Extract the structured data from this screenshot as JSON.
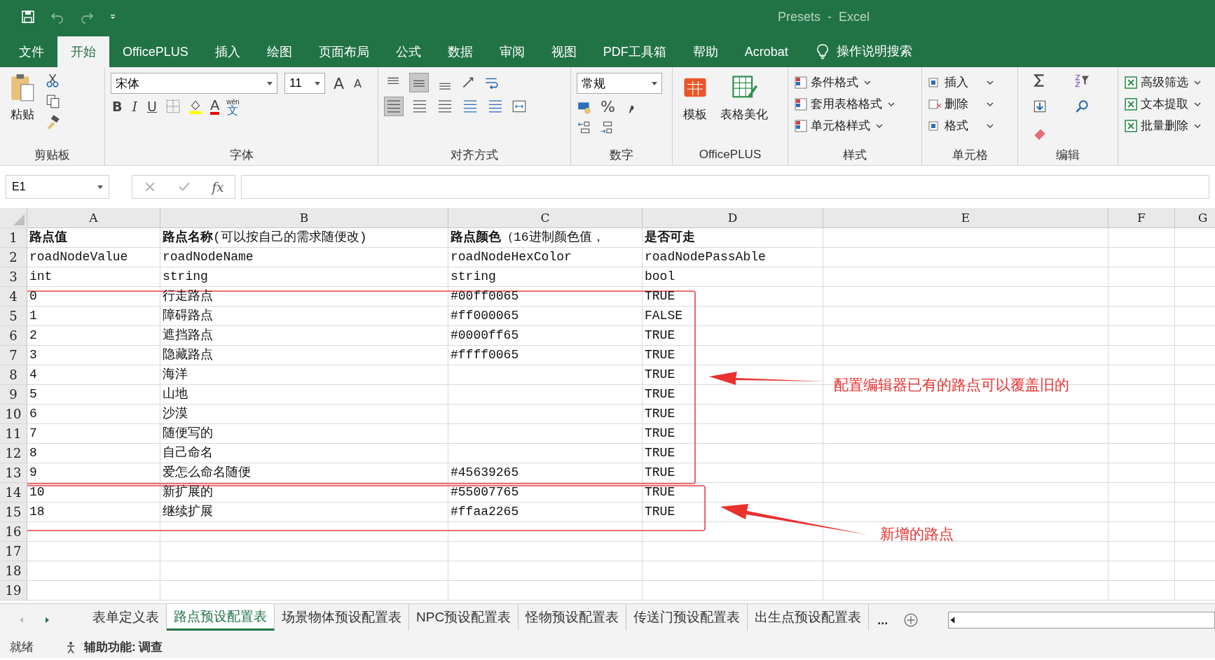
{
  "title_bar": {
    "title": "Presets  -  Excel"
  },
  "menu_tabs": [
    {
      "label": "文件",
      "selected": false
    },
    {
      "label": "开始",
      "selected": true
    },
    {
      "label": "OfficePLUS",
      "selected": false
    },
    {
      "label": "插入",
      "selected": false
    },
    {
      "label": "绘图",
      "selected": false
    },
    {
      "label": "页面布局",
      "selected": false
    },
    {
      "label": "公式",
      "selected": false
    },
    {
      "label": "数据",
      "selected": false
    },
    {
      "label": "审阅",
      "selected": false
    },
    {
      "label": "视图",
      "selected": false
    },
    {
      "label": "PDF工具箱",
      "selected": false
    },
    {
      "label": "帮助",
      "selected": false
    },
    {
      "label": "Acrobat",
      "selected": false
    }
  ],
  "tell_me": "操作说明搜索",
  "ribbon": {
    "clipboard": {
      "label": "剪贴板",
      "paste": "粘贴"
    },
    "font": {
      "label": "字体",
      "font_name": "宋体",
      "font_size": "11",
      "grow": "A",
      "shrink": "A",
      "format_buttons": [
        "B",
        "I",
        "U"
      ],
      "font_color": "A",
      "pinyin": "wén",
      "phonetic": "文"
    },
    "alignment": {
      "label": "对齐方式"
    },
    "number": {
      "label": "数字",
      "format": "常规",
      "percent": "%"
    },
    "officeplus": {
      "label": "OfficePLUS",
      "buttons": [
        "模板",
        "表格美化"
      ]
    },
    "styles": {
      "label": "样式",
      "buttons": [
        "条件格式",
        "套用表格格式",
        "单元格样式"
      ]
    },
    "cells": {
      "label": "单元格",
      "buttons": [
        "插入",
        "删除",
        "格式"
      ]
    },
    "editing": {
      "label": "编辑"
    },
    "extra": {
      "buttons": [
        "高级筛选",
        "文本提取",
        "批量删除"
      ]
    }
  },
  "formula_bar": {
    "name_box": "E1",
    "function_symbol": "fx"
  },
  "columns": [
    "A",
    "B",
    "C",
    "D",
    "E",
    "F",
    "G"
  ],
  "rows": [
    {
      "number": "1",
      "cells": [
        {
          "text": "路点值",
          "bold": true
        },
        {
          "text": "**路点名称**(可以按自己的需求随便改)",
          "bold": false
        },
        {
          "text": "**路点颜色**（16进制颜色值，",
          "bold": false
        },
        {
          "text": "是否可走",
          "bold": true
        }
      ]
    },
    {
      "number": "2",
      "cells": [
        "roadNodeValue",
        "roadNodeName",
        "roadNodeHexColor",
        "roadNodePassAble"
      ]
    },
    {
      "number": "3",
      "cells": [
        "int",
        "string",
        "string",
        "bool"
      ]
    },
    {
      "number": "4",
      "cells": [
        "0",
        "行走路点",
        "#00ff0065",
        "TRUE"
      ]
    },
    {
      "number": "5",
      "cells": [
        "1",
        "障碍路点",
        "#ff000065",
        "FALSE"
      ]
    },
    {
      "number": "6",
      "cells": [
        "2",
        "遮挡路点",
        "#0000ff65",
        "TRUE"
      ]
    },
    {
      "number": "7",
      "cells": [
        "3",
        "隐藏路点",
        "#ffff0065",
        "TRUE"
      ]
    },
    {
      "number": "8",
      "cells": [
        "4",
        "海洋",
        null,
        "TRUE"
      ]
    },
    {
      "number": "9",
      "cells": [
        "5",
        "山地",
        null,
        "TRUE"
      ]
    },
    {
      "number": "10",
      "cells": [
        "6",
        "沙漠",
        null,
        "TRUE"
      ]
    },
    {
      "number": "11",
      "cells": [
        "7",
        "随便写的",
        null,
        "TRUE"
      ]
    },
    {
      "number": "12",
      "cells": [
        "8",
        "自己命名",
        null,
        "TRUE"
      ]
    },
    {
      "number": "13",
      "cells": [
        "9",
        "爱怎么命名随便",
        "#45639265",
        "TRUE"
      ]
    },
    {
      "number": "14",
      "cells": [
        "10",
        "新扩展的",
        "#55007765",
        "TRUE"
      ]
    },
    {
      "number": "15",
      "cells": [
        "18",
        "继续扩展",
        "#ffaa2265",
        "TRUE"
      ]
    },
    {
      "number": "16",
      "cells": []
    },
    {
      "number": "17",
      "cells": []
    },
    {
      "number": "18",
      "cells": []
    },
    {
      "number": "19",
      "cells": []
    }
  ],
  "annotations": [
    {
      "text": "配置编辑器已有的路点可以覆盖旧的"
    },
    {
      "text": "新增的路点"
    }
  ],
  "sheet_tabs": [
    {
      "label": "表单定义表",
      "selected": false
    },
    {
      "label": "路点预设配置表",
      "selected": true
    },
    {
      "label": "场景物体预设配置表",
      "selected": false
    },
    {
      "label": "NPC预设配置表",
      "selected": false
    },
    {
      "label": "怪物预设配置表",
      "selected": false
    },
    {
      "label": "传送门预设配置表",
      "selected": false
    },
    {
      "label": "出生点预设配置表",
      "selected": false
    }
  ],
  "more_tabs": "...",
  "status_bar": {
    "ready": "就绪",
    "accessibility": "辅助功能: 调查"
  }
}
